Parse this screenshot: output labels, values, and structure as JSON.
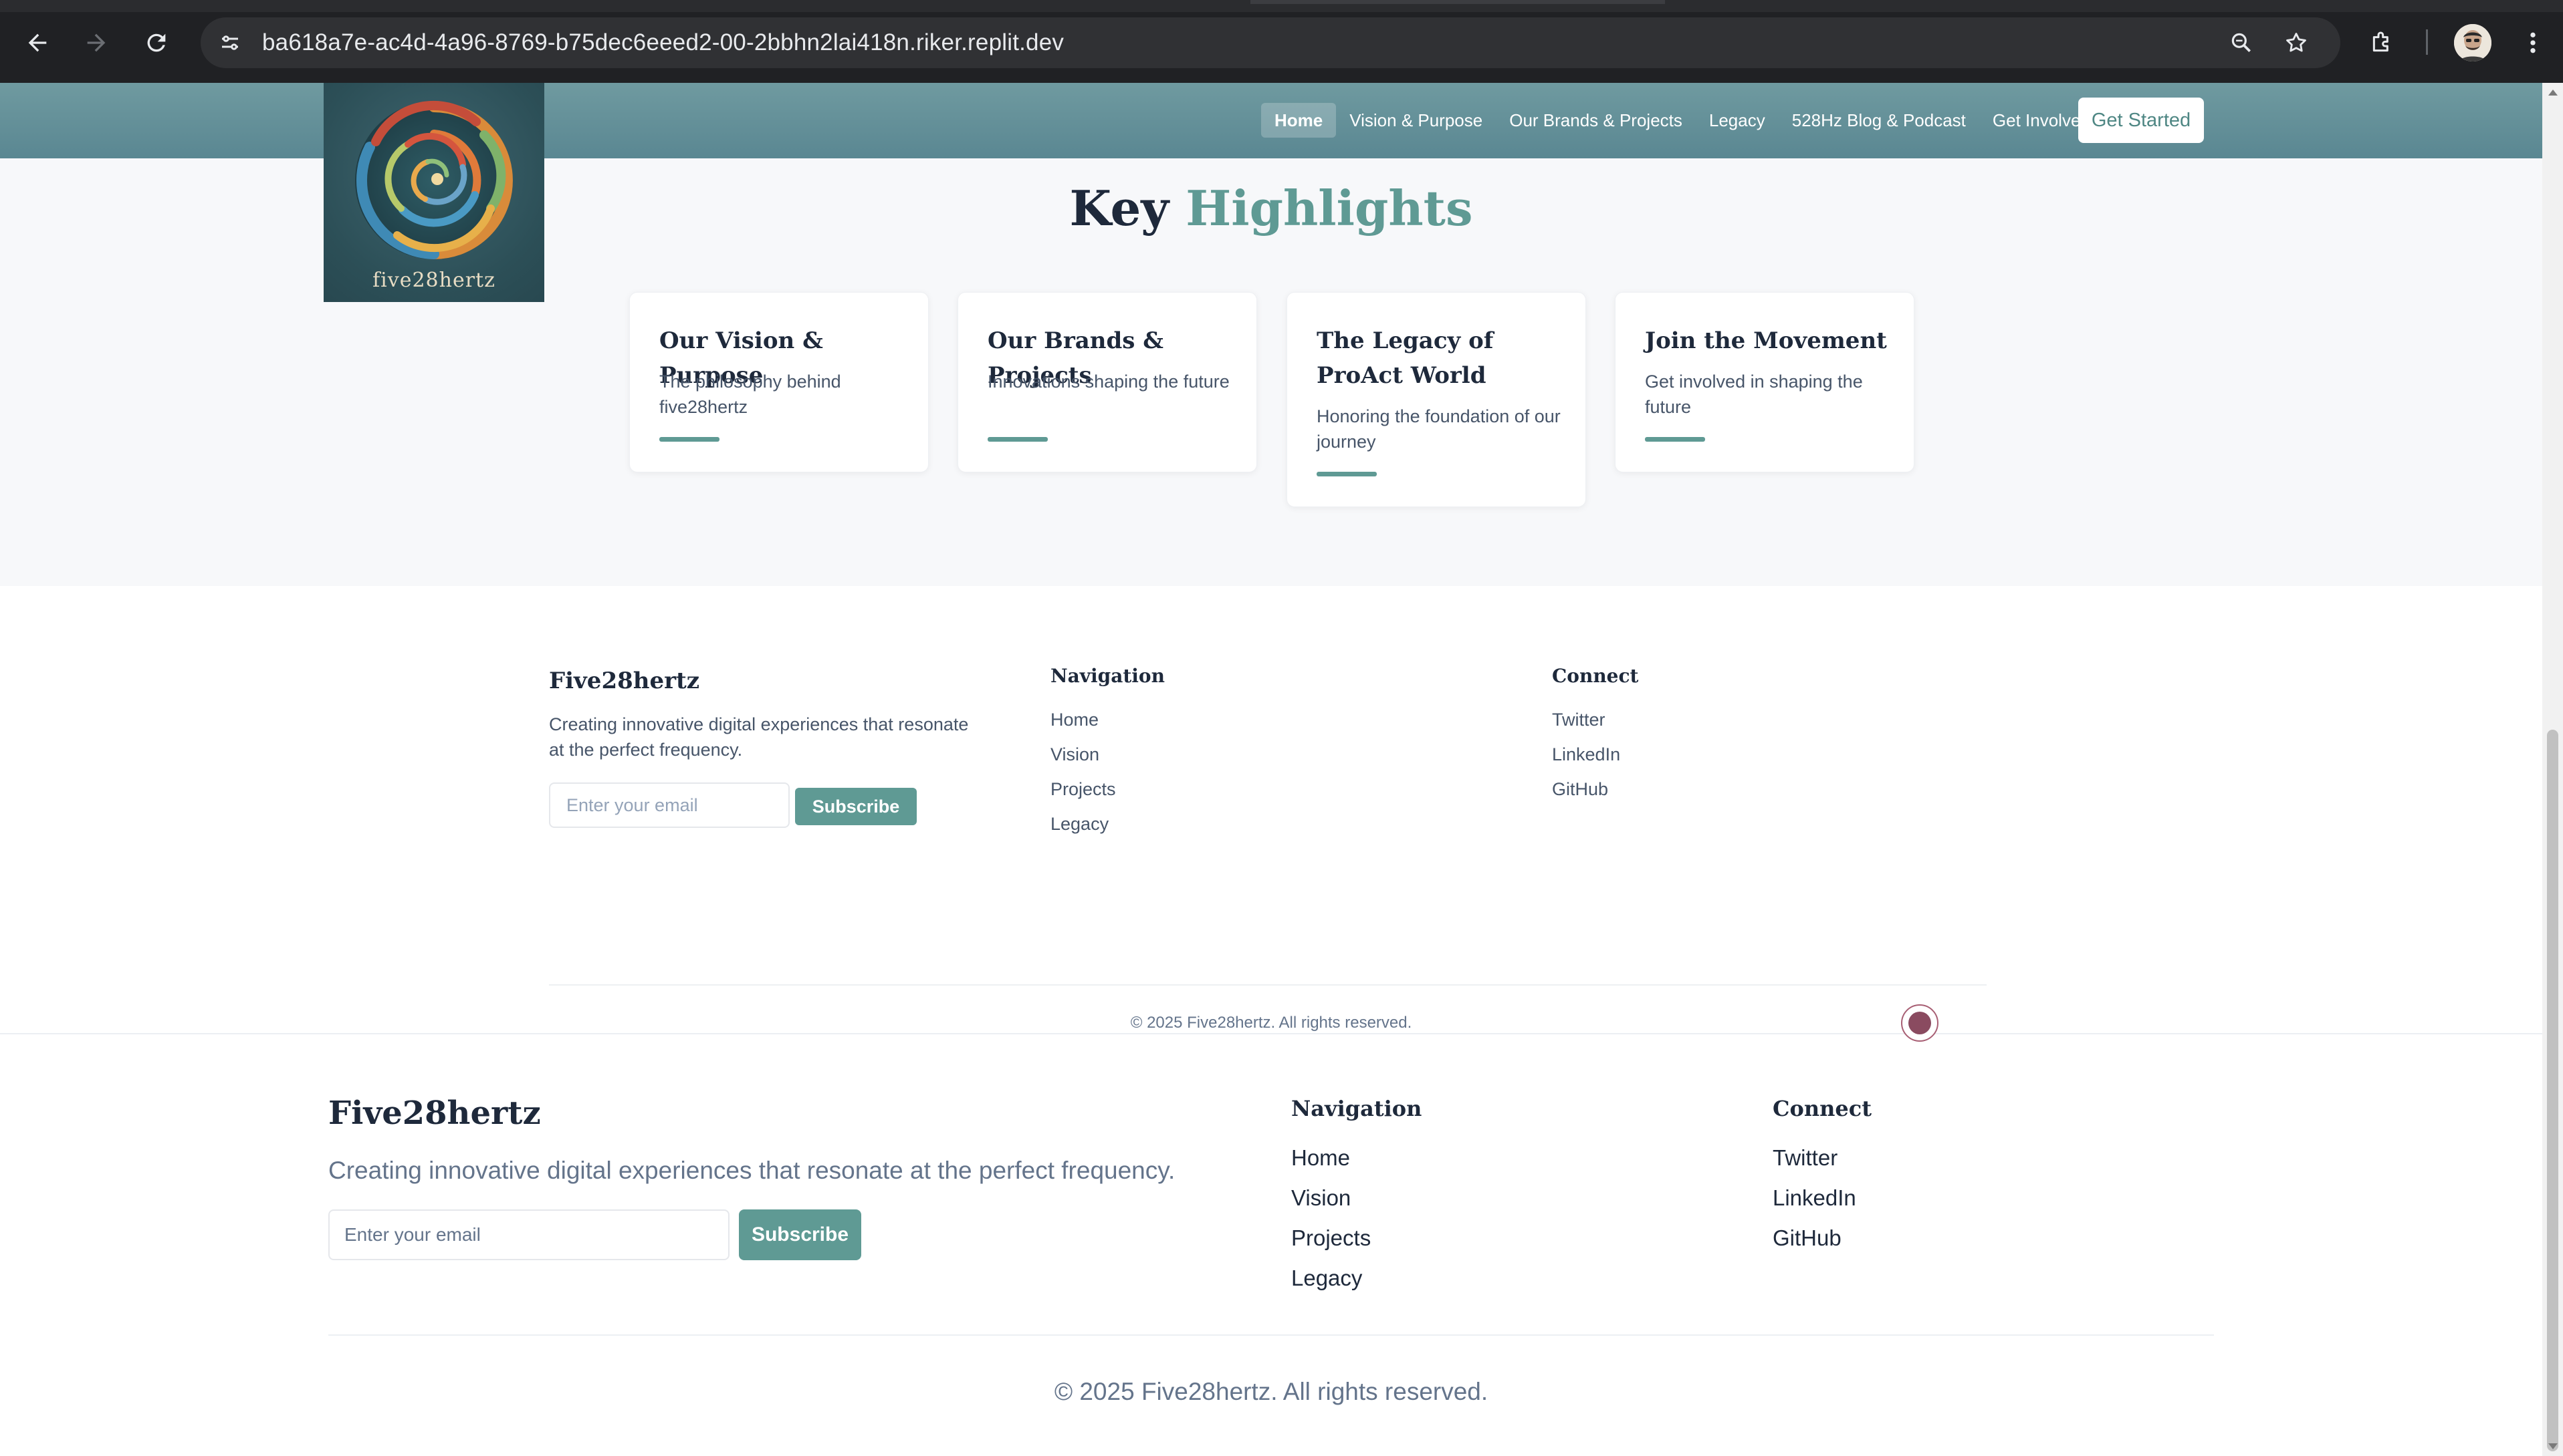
{
  "browser": {
    "url": "ba618a7e-ac4d-4a96-8769-b75dec6eeed2-00-2bbhn2lai418n.riker.replit.dev",
    "icons": [
      "back-icon",
      "forward-icon",
      "reload-icon",
      "site-info-icon",
      "zoom-icon",
      "bookmark-star-icon",
      "extensions-icon",
      "profile-avatar-icon"
    ]
  },
  "header": {
    "logo_text": "five28hertz",
    "menu": [
      {
        "label": "Home",
        "active": true
      },
      {
        "label": "Vision & Purpose"
      },
      {
        "label": "Our Brands & Projects"
      },
      {
        "label": "Legacy"
      },
      {
        "label": "528Hz Blog & Podcast"
      },
      {
        "label": "Get Involved"
      }
    ],
    "cta": "Get Started"
  },
  "highlights": {
    "title_main": "Key",
    "title_accent": "Highlights",
    "cards": [
      {
        "title": "Our Vision & Purpose",
        "text": "The philosophy behind five28hertz"
      },
      {
        "title": "Our Brands & Projects",
        "text": "Innovations shaping the future"
      },
      {
        "title": "The Legacy of ProAct World",
        "text": "Honoring the foundation of our journey"
      },
      {
        "title": "Join the Movement",
        "text": "Get involved in shaping the future"
      }
    ]
  },
  "footer_small": {
    "brand": "Five28hertz",
    "description": "Creating innovative digital experiences that resonate at the perfect frequency.",
    "email_placeholder": "Enter your email",
    "subscribe": "Subscribe",
    "nav_title": "Navigation",
    "nav_links": [
      "Home",
      "Vision",
      "Projects",
      "Legacy"
    ],
    "connect_title": "Connect",
    "connect_links": [
      "Twitter",
      "LinkedIn",
      "GitHub"
    ],
    "copyright": "© 2025 Five28hertz. All rights reserved."
  },
  "footer_large": {
    "brand": "Five28hertz",
    "description": "Creating innovative digital experiences that resonate at the perfect frequency.",
    "email_placeholder": "Enter your email",
    "subscribe": "Subscribe",
    "nav_title": "Navigation",
    "nav_links": [
      "Home",
      "Vision",
      "Projects",
      "Legacy"
    ],
    "connect_title": "Connect",
    "connect_links": [
      "Twitter",
      "LinkedIn",
      "GitHub"
    ],
    "copyright": "© 2025 Five28hertz. All rights reserved."
  },
  "colors": {
    "accent": "#5f9a94",
    "header": "#6f9aa0",
    "dark_text": "#1e293b"
  }
}
